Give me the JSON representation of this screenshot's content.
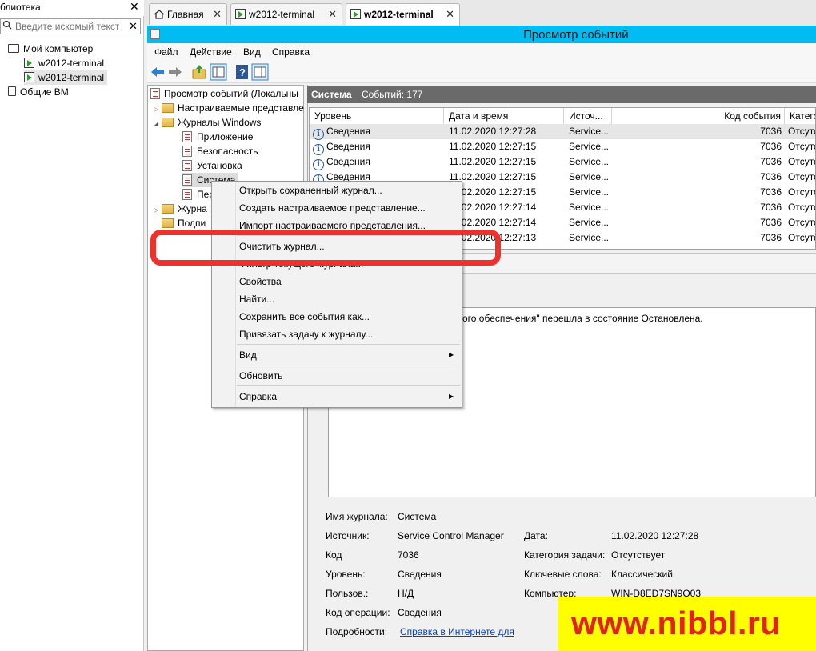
{
  "library": {
    "title": "блиотека",
    "close": "✕",
    "search_placeholder": "Введите искомый текст",
    "search_clear": "✕",
    "tree": [
      {
        "label": "Мой компьютер"
      },
      {
        "label": "w2012-terminal"
      },
      {
        "label": "w2012-terminal"
      },
      {
        "label": "Общие ВМ"
      }
    ]
  },
  "tabs": [
    {
      "label": "Главная",
      "close": "✕"
    },
    {
      "label": "w2012-terminal",
      "close": "✕"
    },
    {
      "label": "w2012-terminal",
      "close": "✕"
    }
  ],
  "window": {
    "title": "Просмотр событий"
  },
  "menu": [
    "Файл",
    "Действие",
    "Вид",
    "Справка"
  ],
  "navtree": {
    "root": "Просмотр событий (Локальны",
    "custom_views": "Настраиваемые представле",
    "windows_logs": "Журналы Windows",
    "logs": [
      "Приложение",
      "Безопасность",
      "Установка",
      "Система",
      "Пер"
    ],
    "apps_logs": "Журна",
    "subscriptions": "Подпи"
  },
  "content": {
    "log_name": "Система",
    "events_count": "Событий: 177",
    "columns": [
      "Уровень",
      "Дата и время",
      "Источ...",
      "Код события",
      "Катего"
    ],
    "rows": [
      {
        "level": "Сведения",
        "date": "11.02.2020 12:27:28",
        "source": "Service...",
        "code": "7036",
        "category": "Отсутс"
      },
      {
        "level": "Сведения",
        "date": "11.02.2020 12:27:15",
        "source": "Service...",
        "code": "7036",
        "category": "Отсутс"
      },
      {
        "level": "Сведения",
        "date": "11.02.2020 12:27:15",
        "source": "Service...",
        "code": "7036",
        "category": "Отсутс"
      },
      {
        "level": "Сведения",
        "date": "11.02.2020 12:27:15",
        "source": "Service...",
        "code": "7036",
        "category": "Отсутс"
      },
      {
        "level": "Сведения",
        "date": "11.02.2020 12:27:15",
        "source": "Service...",
        "code": "7036",
        "category": "Отсутс"
      },
      {
        "level": "Сведения",
        "date": "11.02.2020 12:27:14",
        "source": "Service...",
        "code": "7036",
        "category": "Отсутс"
      },
      {
        "level": "Сведения",
        "date": "11.02.2020 12:27:14",
        "source": "Service...",
        "code": "7036",
        "category": "Отсутс"
      },
      {
        "level": "Сведения",
        "date": "11.02.2020 12:27:13",
        "source": "Service...",
        "code": "7036",
        "category": "Отсутс"
      }
    ],
    "message": "ого обеспечения\" перешла в состояние Остановлена.",
    "details": {
      "log_label": "Имя журнала:",
      "log_value": "Система",
      "source_label": "Источник:",
      "source_value": "Service Control Manager",
      "date_label": "Дата:",
      "date_value": "11.02.2020 12:27:28",
      "code_label": "Код",
      "code_value": "7036",
      "task_label": "Категория задачи:",
      "task_value": "Отсутствует",
      "level_label": "Уровень:",
      "level_value": "Сведения",
      "keywords_label": "Ключевые слова:",
      "keywords_value": "Классический",
      "user_label": "Пользов.:",
      "user_value": "Н/Д",
      "computer_label": "Компьютер:",
      "computer_value": "WIN-D8ED7SN9O03",
      "opcode_label": "Код операции:",
      "opcode_value": "Сведения",
      "more_label": "Подробности:",
      "more_link": "Справка в Интернете для"
    }
  },
  "context_menu": {
    "items": [
      "Открыть сохраненный журнал...",
      "Создать настраиваемое представление...",
      "Импорт настраиваемого представления...",
      "Очистить журнал...",
      "Фильтр текущего журнала...",
      "Свойства",
      "Найти...",
      "Сохранить все события как...",
      "Привязать задачу к журналу...",
      "Вид",
      "Обновить",
      "Справка"
    ],
    "submenu_arrow": "▶"
  },
  "watermark": "www.nibbl.ru",
  "colors": {
    "titlebar": "#00bcf2",
    "highlight": "#f0302a",
    "watermark_bg": "#ffff00",
    "watermark_text": "#e2231a"
  }
}
